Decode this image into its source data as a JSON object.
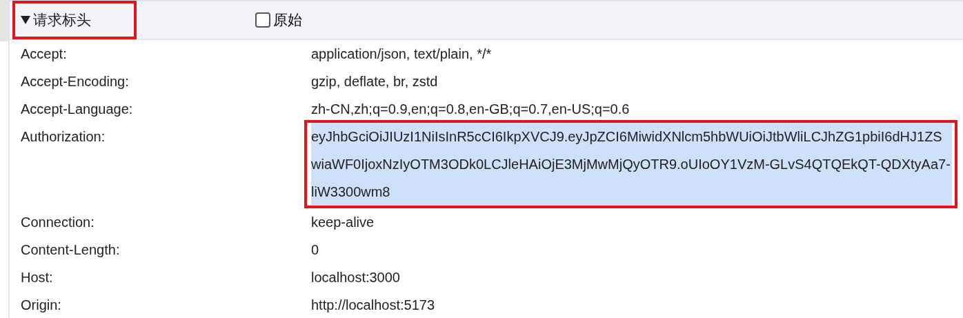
{
  "section": {
    "title": "请求标头",
    "expanded": true,
    "annotated": true,
    "raw_toggle": {
      "label": "原始",
      "checked": false
    }
  },
  "headers": [
    {
      "name": "Accept:",
      "value": "application/json, text/plain, */*",
      "selected": false,
      "annotated": false
    },
    {
      "name": "Accept-Encoding:",
      "value": "gzip, deflate, br, zstd",
      "selected": false,
      "annotated": false
    },
    {
      "name": "Accept-Language:",
      "value": "zh-CN,zh;q=0.9,en;q=0.8,en-GB;q=0.7,en-US;q=0.6",
      "selected": false,
      "annotated": false
    },
    {
      "name": "Authorization:",
      "value": "eyJhbGciOiJIUzI1NiIsInR5cCI6IkpXVCJ9.eyJpZCI6MiwidXNlcm5hbWUiOiJtbWliLCJhZG1pbiI6dHJ1ZSwiaWF0IjoxNzIyOTM3ODk0LCJleHAiOjE3MjMwMjQyOTR9.oUIoOY1VzM-GLvS4QTQEkQT-QDXtyAa7-liW3300wm8",
      "selected": true,
      "annotated": true
    },
    {
      "name": "Connection:",
      "value": "keep-alive",
      "selected": false,
      "annotated": false
    },
    {
      "name": "Content-Length:",
      "value": "0",
      "selected": false,
      "annotated": false
    },
    {
      "name": "Host:",
      "value": "localhost:3000",
      "selected": false,
      "annotated": false
    },
    {
      "name": "Origin:",
      "value": "http://localhost:5173",
      "selected": false,
      "annotated": false
    }
  ]
}
